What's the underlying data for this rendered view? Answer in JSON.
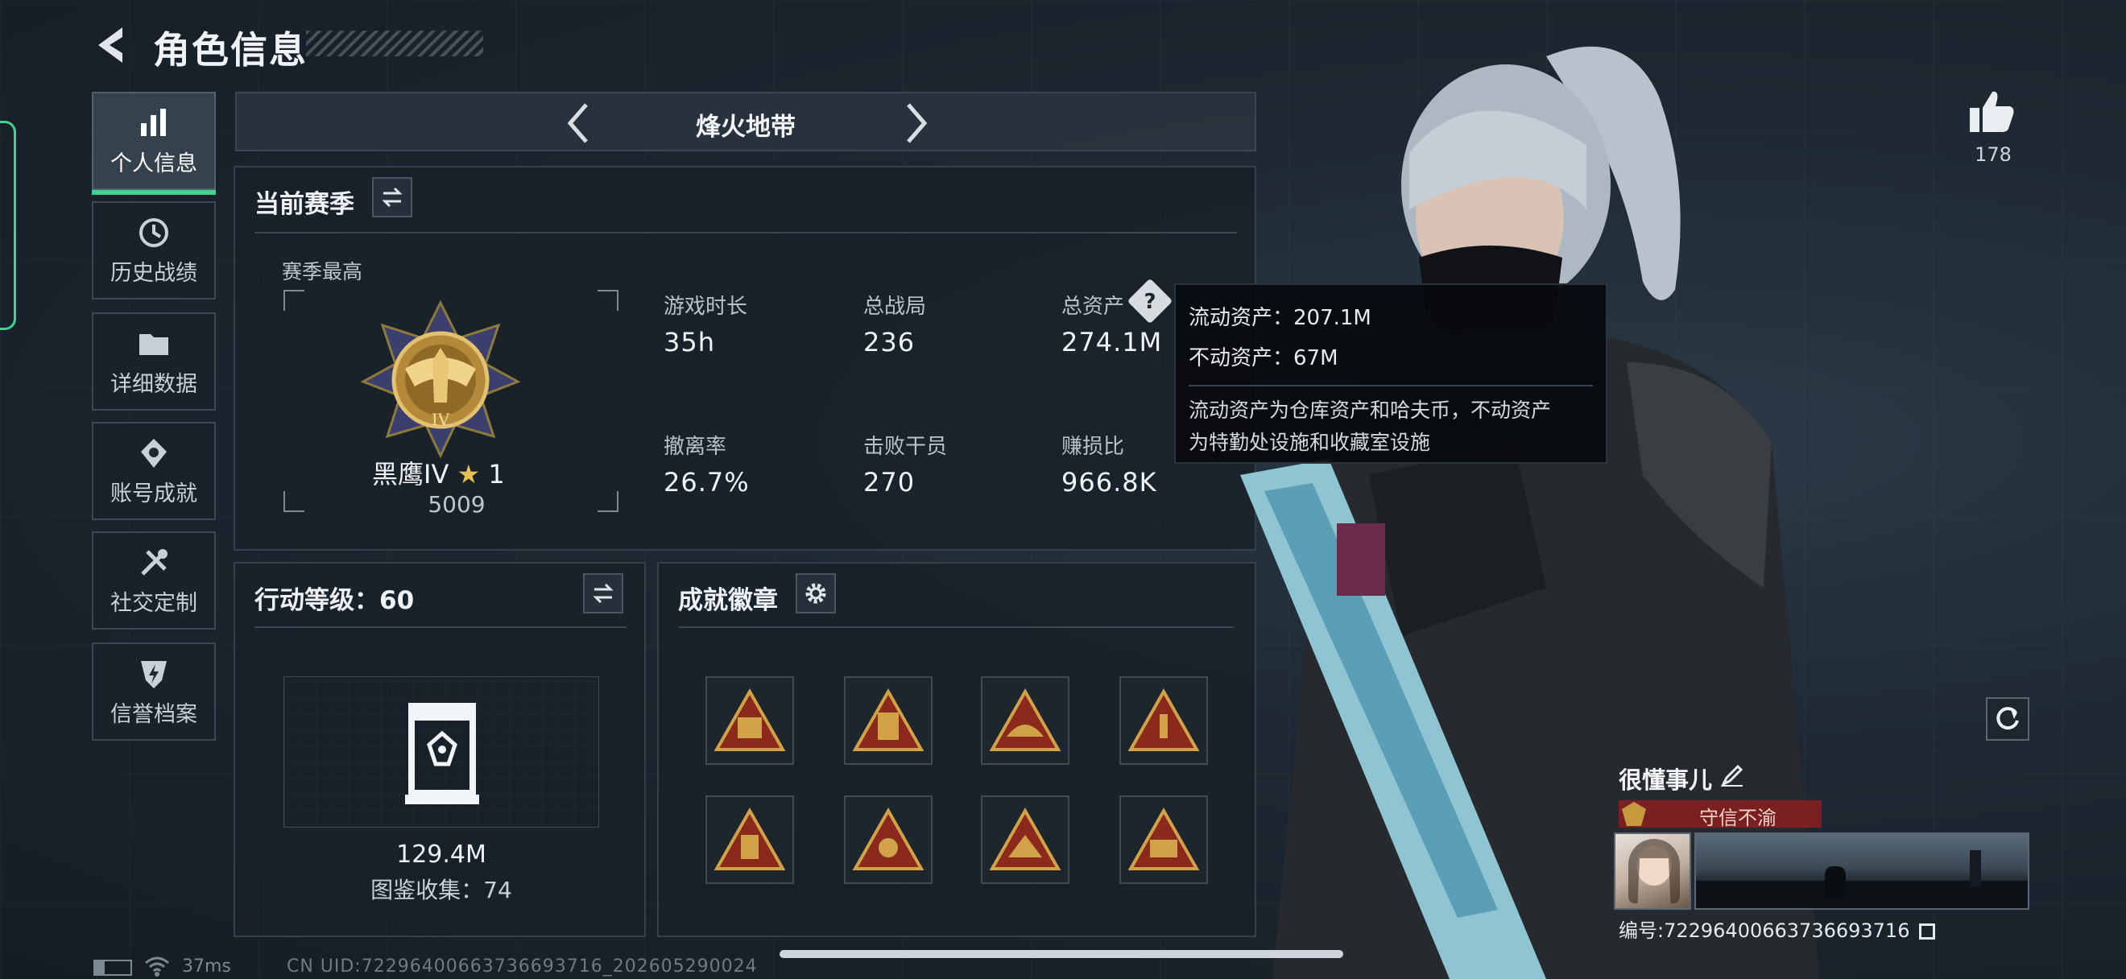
{
  "header": {
    "title": "角色信息"
  },
  "sidebar": {
    "items": [
      {
        "label": "个人信息",
        "icon": "bar-chart-icon",
        "active": true
      },
      {
        "label": "历史战绩",
        "icon": "clock-history-icon",
        "active": false
      },
      {
        "label": "详细数据",
        "icon": "folder-icon",
        "active": false
      },
      {
        "label": "账号成就",
        "icon": "medal-icon",
        "active": false
      },
      {
        "label": "社交定制",
        "icon": "tools-icon",
        "active": false
      },
      {
        "label": "信誉档案",
        "icon": "shield-bolt-icon",
        "active": false
      }
    ]
  },
  "mode_tab": {
    "title": "烽火地带"
  },
  "season": {
    "title": "当前赛季",
    "best_label": "赛季最高",
    "rank_name": "黑鹰IV",
    "rank_stars": "1",
    "rank_score": "5009",
    "stats": [
      {
        "label": "游戏时长",
        "value": "35h"
      },
      {
        "label": "总战局",
        "value": "236"
      },
      {
        "label": "总资产",
        "value": "274.1M"
      },
      {
        "label": "撤离率",
        "value": "26.7%"
      },
      {
        "label": "击败干员",
        "value": "270"
      },
      {
        "label": "赚损比",
        "value": "966.8K"
      }
    ]
  },
  "tooltip": {
    "line1": "流动资产：207.1M",
    "line2": "不动资产：67M",
    "desc1": "流动资产为仓库资产和哈夫币，不动资产",
    "desc2": "为特勤处设施和收藏室设施"
  },
  "action_level": {
    "title": "行动等级：60",
    "value": "129.4M",
    "collection": "图鉴收集：74"
  },
  "achievements": {
    "title": "成就徽章",
    "badges": [
      "badge-icon",
      "badge-icon",
      "badge-icon",
      "badge-icon",
      "badge-icon",
      "badge-icon",
      "badge-icon",
      "badge-icon"
    ]
  },
  "likes": {
    "count": "178"
  },
  "player": {
    "name": "很懂事儿",
    "title_badge": "守信不渝",
    "id_text": "编号:7229640066373669​3716"
  },
  "status_bar": {
    "ping": "37ms",
    "uid": "CN UID:7229640066373669​3716_202605290024"
  },
  "colors": {
    "accent": "#3fd38f",
    "badge_red": "#7a1f22",
    "gold": "#c9a14a"
  }
}
